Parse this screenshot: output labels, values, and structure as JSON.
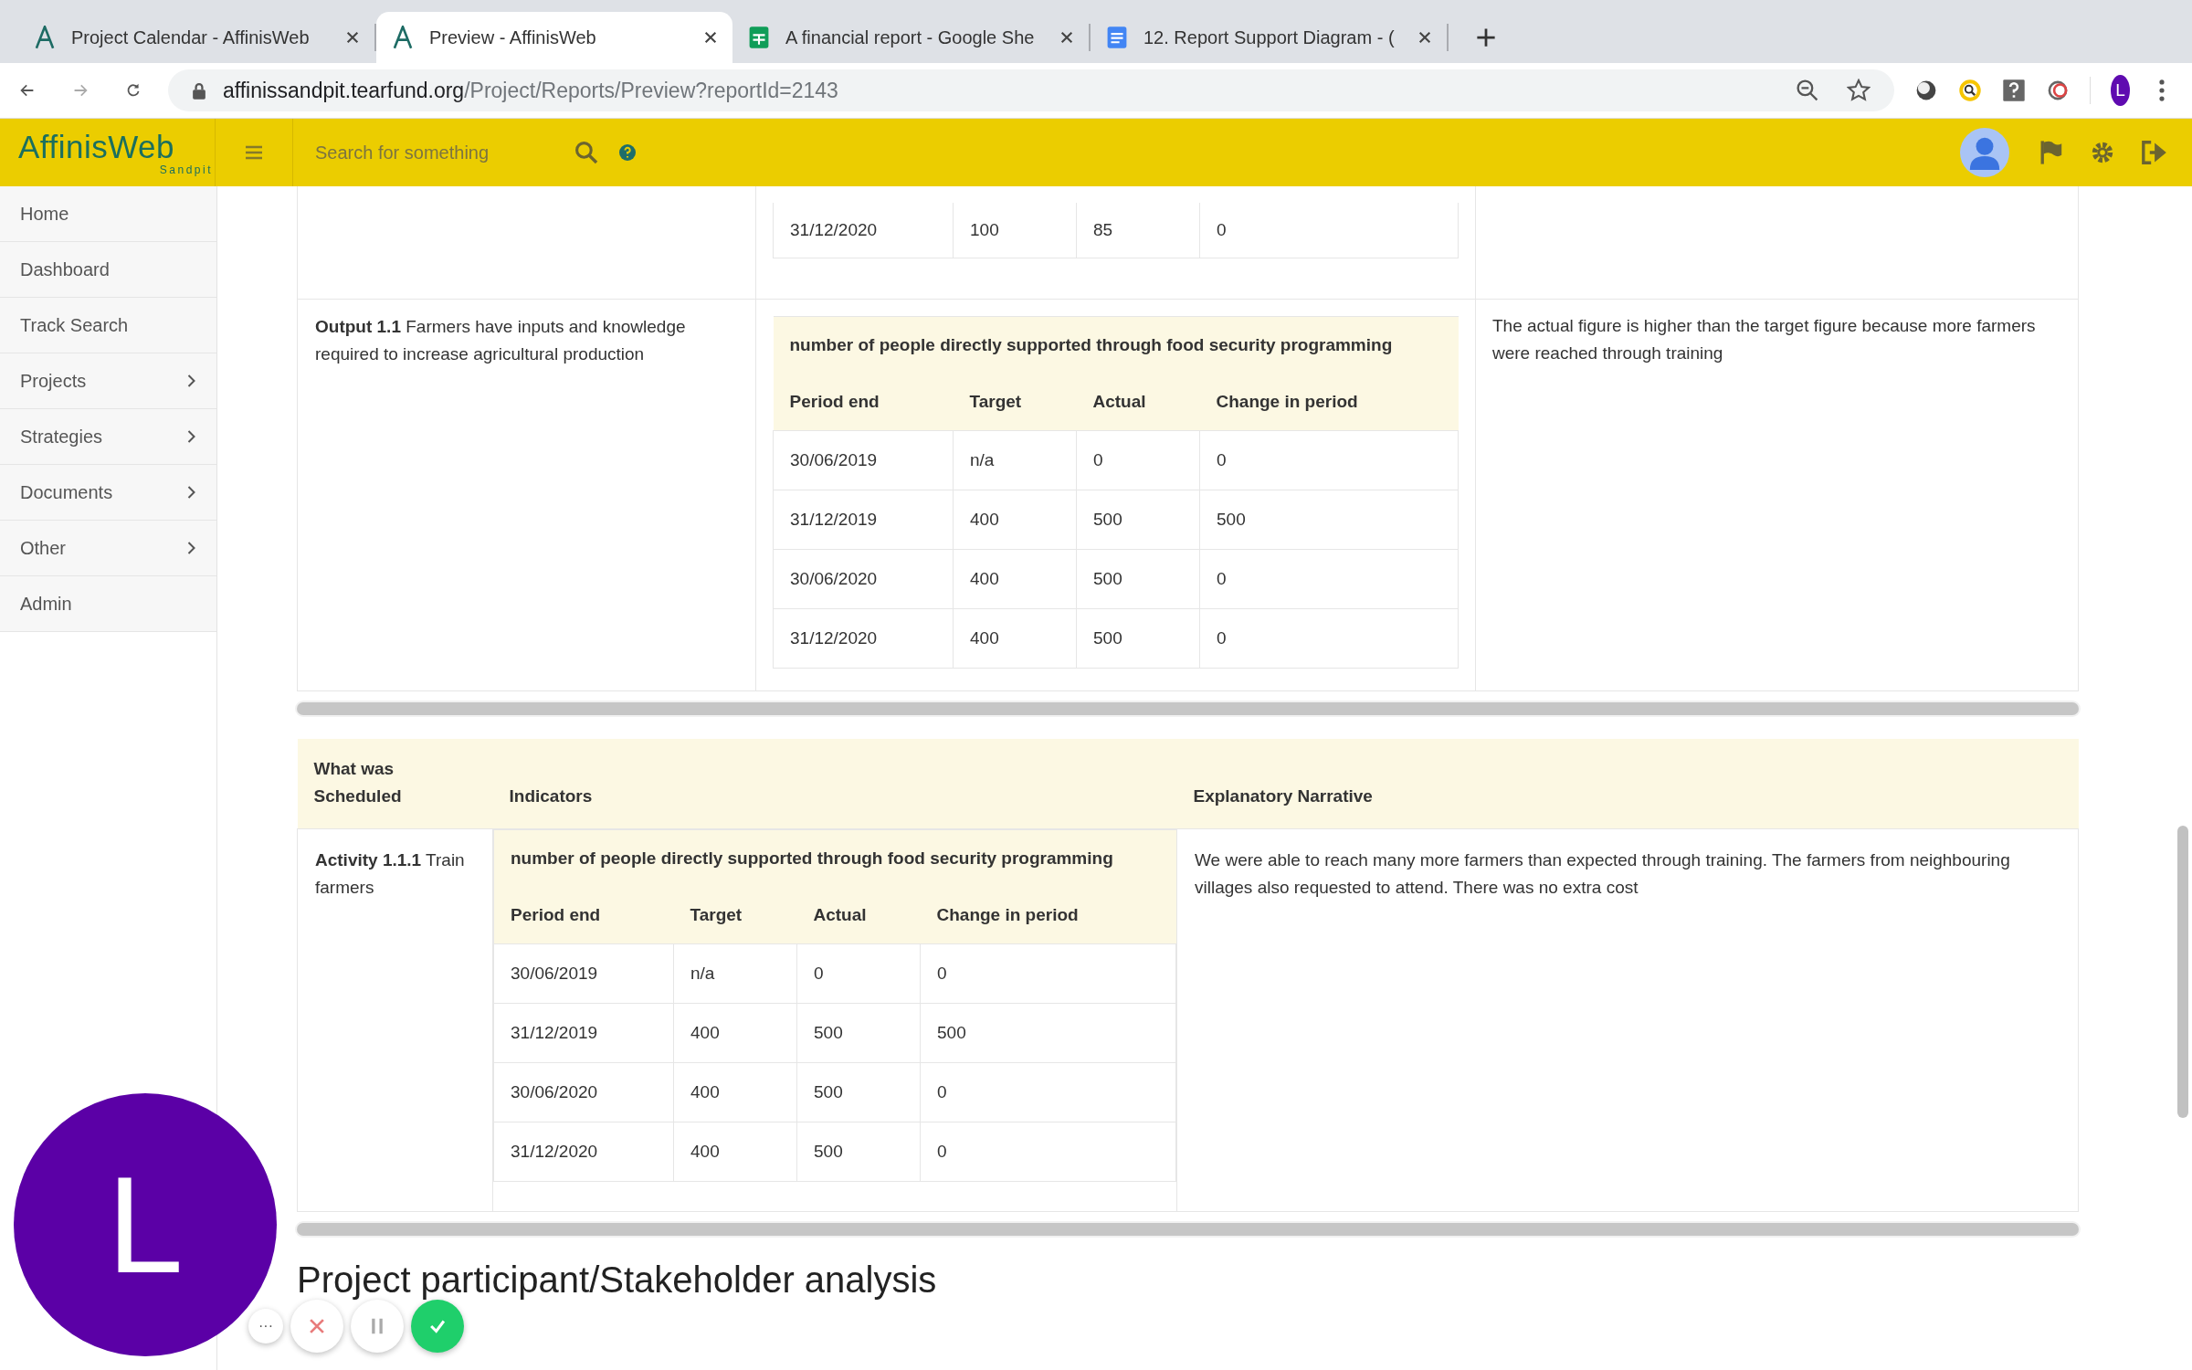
{
  "browser": {
    "tabs": [
      {
        "title": "Project Calendar - AffinisWeb",
        "kind": "affinis",
        "selected": false
      },
      {
        "title": "Preview - AffinisWeb",
        "kind": "affinis",
        "selected": true
      },
      {
        "title": "A financial report - Google She",
        "kind": "sheets",
        "selected": false
      },
      {
        "title": "12. Report Support Diagram - (",
        "kind": "docs",
        "selected": false
      }
    ],
    "url": {
      "host": "affinissandpit.tearfund.org",
      "path": "/Project/Reports/Preview?reportId=2143"
    },
    "profile_initial": "L"
  },
  "header": {
    "logo": "AffinisWeb",
    "logo_sub": "Sandpit",
    "search": {
      "placeholder": "Search for something"
    }
  },
  "sidebar": {
    "items": [
      {
        "label": "Home",
        "expandable": false
      },
      {
        "label": "Dashboard",
        "expandable": false
      },
      {
        "label": "Track Search",
        "expandable": false
      },
      {
        "label": "Projects",
        "expandable": true
      },
      {
        "label": "Strategies",
        "expandable": true
      },
      {
        "label": "Documents",
        "expandable": true
      },
      {
        "label": "Other",
        "expandable": true
      },
      {
        "label": "Admin",
        "expandable": false
      }
    ]
  },
  "outputs_table": {
    "rows": [
      {
        "description": "",
        "indicator": {
          "rows": [
            [
              "31/12/2020",
              "100",
              "85",
              "0"
            ]
          ]
        },
        "narrative": ""
      },
      {
        "description": "**Output 1.1** Farmers have inputs and knowledge required to increase agricultural production",
        "indicator": {
          "title": "number of people directly supported through food security programming",
          "columns": [
            "Period end",
            "Target",
            "Actual",
            "Change in period"
          ],
          "rows": [
            [
              "30/06/2019",
              "n/a",
              "0",
              "0"
            ],
            [
              "31/12/2019",
              "400",
              "500",
              "500"
            ],
            [
              "30/06/2020",
              "400",
              "500",
              "0"
            ],
            [
              "31/12/2020",
              "400",
              "500",
              "0"
            ]
          ]
        },
        "narrative": "The actual figure is higher than the target figure because more farmers were reached through training"
      }
    ]
  },
  "activities_table": {
    "columns": [
      "What was Scheduled",
      "Indicators",
      "Explanatory Narrative"
    ],
    "rows": [
      {
        "description": "**Activity 1.1.1** Train farmers",
        "indicator": {
          "title": "number of people directly supported through food security programming",
          "columns": [
            "Period end",
            "Target",
            "Actual",
            "Change in period"
          ],
          "rows": [
            [
              "30/06/2019",
              "n/a",
              "0",
              "0"
            ],
            [
              "31/12/2019",
              "400",
              "500",
              "500"
            ],
            [
              "30/06/2020",
              "400",
              "500",
              "0"
            ],
            [
              "31/12/2020",
              "400",
              "500",
              "0"
            ]
          ]
        },
        "narrative": "We were able to reach many more farmers than expected through training. The farmers from neighbouring villages also requested to attend. There was no extra cost"
      }
    ]
  },
  "section_heading": "Project participant/Stakeholder analysis",
  "video_overlay": {
    "initial": "L",
    "controls": [
      {
        "kind": "more",
        "label": "···"
      },
      {
        "kind": "cancel"
      },
      {
        "kind": "pause"
      },
      {
        "kind": "done"
      }
    ]
  }
}
